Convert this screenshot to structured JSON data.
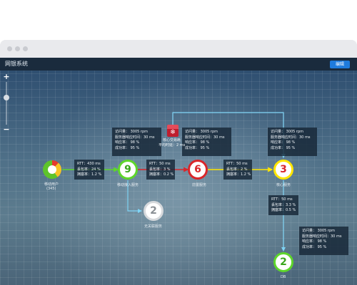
{
  "app": {
    "title": "网银系统",
    "edit_button": "编辑"
  },
  "zoom": {
    "plus": "+",
    "minus": "−"
  },
  "colors": {
    "green": "#5ed62b",
    "red": "#d9262a",
    "yellow": "#ffe600",
    "blue_link": "#7fd4f5",
    "titlebar": "#1a2b3d",
    "button": "#1f7bdc"
  },
  "nodes": {
    "mobile_user": {
      "label": "移动用户",
      "count": "(345)"
    },
    "mobile_access": {
      "value": "9",
      "label": "移动接入服务"
    },
    "frontend": {
      "value": "6",
      "label": "前置服务"
    },
    "core": {
      "value": "3",
      "label": "核心服务"
    },
    "db": {
      "value": "2",
      "label": "DB"
    },
    "unrelated": {
      "value": "2",
      "label": "无关联服务"
    }
  },
  "alert_icon": {
    "icon": "snowflake-alert-icon",
    "label_line1": "核心交易耗",
    "label_line2": "平均时延：2 ms"
  },
  "link_stats": {
    "user_to_access": [
      "RTT：430 ms",
      "丢包率：24 %",
      "拥塞率：1.2 %"
    ],
    "access_to_front": [
      "RTT：50 ms",
      "丢包率：3 %",
      "拥塞率：0.2 %"
    ],
    "front_to_core": [
      "RTT：50 ms",
      "丢包率：2 %",
      "拥塞率：1.2 %"
    ],
    "core_to_db": [
      "RTT：50 ms",
      "丢包率：3.3 %",
      "拥塞率：0.5 %"
    ]
  },
  "service_stats": {
    "access": [
      "访问量：  3005 rpm",
      "服务器响应时间：30 ms",
      "响应率：  98 %",
      "成功率：  95 %"
    ],
    "front": [
      "访问量：  3005 rpm",
      "服务器响应时间：30 ms",
      "响应率：  98 %",
      "成功率：  95 %"
    ],
    "core": [
      "访问量：  3005 rpm",
      "服务器响应时间：30 ms",
      "响应率：  98 %",
      "成功率：  95 %"
    ],
    "db": [
      "访问量：  3005 rpm",
      "服务器响应时间：30 ms",
      "响应率：  98 %",
      "成功率：  95 %"
    ]
  },
  "user_pie": {
    "segments": [
      {
        "name": "red",
        "share": 0.12,
        "color": "#e53a2c"
      },
      {
        "name": "yellow",
        "share": 0.28,
        "color": "#f6c324"
      },
      {
        "name": "green",
        "share": 0.6,
        "color": "#5ec42b"
      }
    ]
  }
}
